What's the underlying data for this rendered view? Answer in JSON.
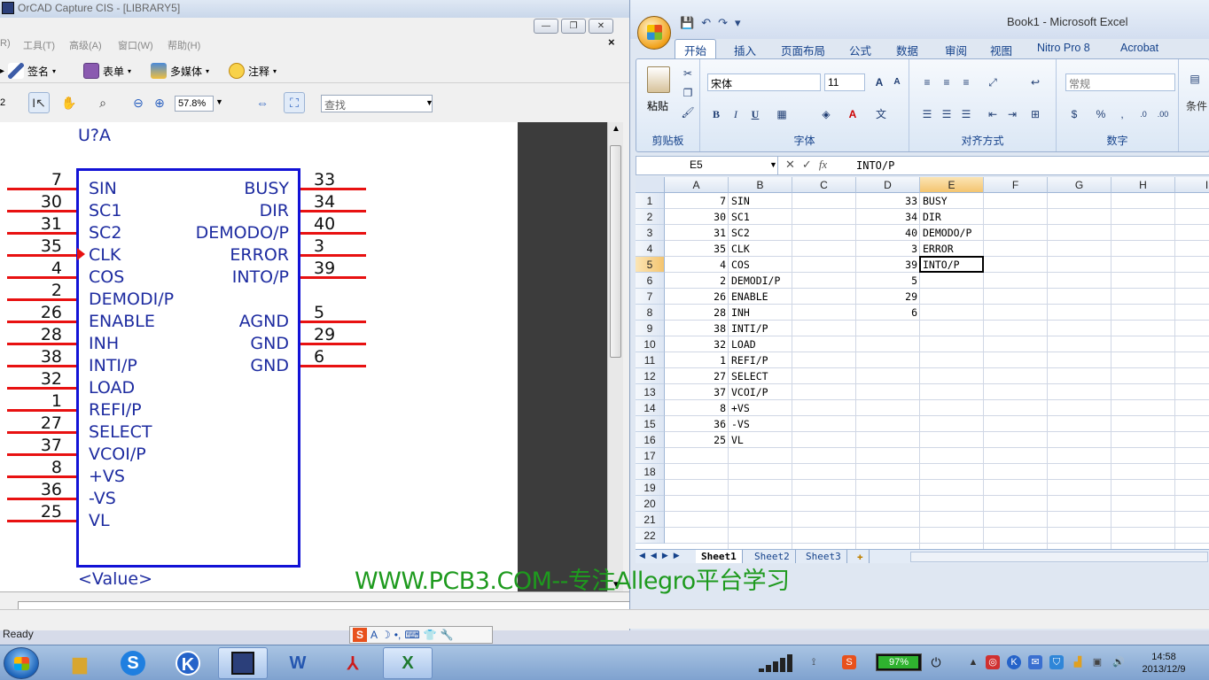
{
  "orcad": {
    "title": "OrCAD Capture CIS - [LIBRARY5]",
    "menu": [
      "R)",
      "工具(T)",
      "高级(A)",
      "窗口(W)",
      "帮助(H)"
    ],
    "toolbar": {
      "sign_label": "签名",
      "form_label": "表单",
      "multimedia_label": "多媒体",
      "comment_label": "注释"
    },
    "toolbar2_prefix": "2",
    "zoom": "57.8%",
    "search_placeholder": "查找",
    "status": "Ready"
  },
  "schematic": {
    "ref": "U?A",
    "value": "<Value>",
    "left_pins": [
      {
        "num": "7",
        "name": "SIN"
      },
      {
        "num": "30",
        "name": "SC1"
      },
      {
        "num": "31",
        "name": "SC2"
      },
      {
        "num": "35",
        "name": "CLK"
      },
      {
        "num": "4",
        "name": "COS"
      },
      {
        "num": "2",
        "name": "DEMODI/P"
      },
      {
        "num": "26",
        "name": "ENABLE"
      },
      {
        "num": "28",
        "name": "INH"
      },
      {
        "num": "38",
        "name": "INTI/P"
      },
      {
        "num": "32",
        "name": "LOAD"
      },
      {
        "num": "1",
        "name": "REFI/P"
      },
      {
        "num": "27",
        "name": "SELECT"
      },
      {
        "num": "37",
        "name": "VCOI/P"
      },
      {
        "num": "8",
        "name": "+VS"
      },
      {
        "num": "36",
        "name": "-VS"
      },
      {
        "num": "25",
        "name": "VL"
      }
    ],
    "right_pins": [
      {
        "num": "33",
        "name": "BUSY"
      },
      {
        "num": "34",
        "name": "DIR"
      },
      {
        "num": "40",
        "name": "DEMODO/P"
      },
      {
        "num": "3",
        "name": "ERROR"
      },
      {
        "num": "39",
        "name": "INTO/P"
      },
      {
        "num": "5",
        "name": "AGND"
      },
      {
        "num": "29",
        "name": "GND"
      },
      {
        "num": "6",
        "name": "GND"
      }
    ]
  },
  "excel": {
    "title": "Book1 - Microsoft Excel",
    "tabs": [
      "开始",
      "插入",
      "页面布局",
      "公式",
      "数据",
      "审阅",
      "视图",
      "Nitro Pro 8",
      "Acrobat"
    ],
    "ribbon": {
      "paste_label": "粘贴",
      "clipboard_label": "剪贴板",
      "font_name": "宋体",
      "font_size": "11",
      "font_group_label": "字体",
      "align_group_label": "对齐方式",
      "number_format": "常规",
      "number_group_label": "数字",
      "cond_label": "条件"
    },
    "name_box": "E5",
    "formula": "INTO/P",
    "columns": [
      "A",
      "B",
      "C",
      "D",
      "E",
      "F",
      "G",
      "H",
      "I"
    ],
    "rows": [
      "1",
      "2",
      "3",
      "4",
      "5",
      "6",
      "7",
      "8",
      "9",
      "10",
      "11",
      "12",
      "13",
      "14",
      "15",
      "16",
      "17",
      "18",
      "19",
      "20",
      "21",
      "22"
    ],
    "data": [
      {
        "A": "7",
        "B": "SIN",
        "D": "33",
        "E": "BUSY"
      },
      {
        "A": "30",
        "B": "SC1",
        "D": "34",
        "E": "DIR"
      },
      {
        "A": "31",
        "B": "SC2",
        "D": "40",
        "E": "DEMODO/P"
      },
      {
        "A": "35",
        "B": "CLK",
        "D": "3",
        "E": "ERROR"
      },
      {
        "A": "4",
        "B": "COS",
        "D": "39",
        "E": "INTO/P"
      },
      {
        "A": "2",
        "B": "DEMODI/P",
        "D": "5",
        "E": ""
      },
      {
        "A": "26",
        "B": "ENABLE",
        "D": "29",
        "E": ""
      },
      {
        "A": "28",
        "B": "INH",
        "D": "6",
        "E": ""
      },
      {
        "A": "38",
        "B": "INTI/P",
        "D": "",
        "E": ""
      },
      {
        "A": "32",
        "B": "LOAD",
        "D": "",
        "E": ""
      },
      {
        "A": "1",
        "B": "REFI/P",
        "D": "",
        "E": ""
      },
      {
        "A": "27",
        "B": "SELECT",
        "D": "",
        "E": ""
      },
      {
        "A": "37",
        "B": "VCOI/P",
        "D": "",
        "E": ""
      },
      {
        "A": "8",
        "B": "+VS",
        "D": "",
        "E": ""
      },
      {
        "A": "36",
        "B": "-VS",
        "D": "",
        "E": ""
      },
      {
        "A": "25",
        "B": "VL",
        "D": "",
        "E": ""
      }
    ],
    "active_cell": "E5",
    "sheets": [
      "Sheet1",
      "Sheet2",
      "Sheet3"
    ],
    "active_sheet": "Sheet1"
  },
  "watermark": "WWW.PCB3.COM--专注Allegro平台学习",
  "taskbar": {
    "battery_percent": 97,
    "battery_label": "97%",
    "time": "14:58",
    "date": "2013/12/9",
    "apps": [
      "explorer-icon",
      "sogou-icon",
      "kugou-icon",
      "orcad-icon",
      "word-icon",
      "pdf-icon",
      "excel-icon"
    ]
  },
  "colors": {
    "pin_red": "#e81111",
    "symbol_blue": "#1212d6",
    "text_navy": "#1d2ba0",
    "watermark_green": "#1e9a1e",
    "excel_active_col": "#f4c46f"
  }
}
